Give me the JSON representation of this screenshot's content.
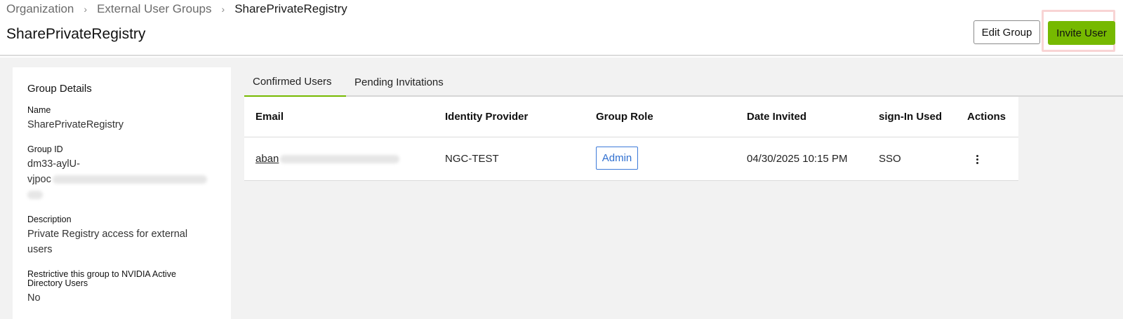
{
  "breadcrumb": {
    "items": [
      "Organization",
      "External User Groups"
    ],
    "current": "SharePrivateRegistry",
    "separator": "›"
  },
  "page": {
    "title": "SharePrivateRegistry"
  },
  "actions": {
    "edit_label": "Edit Group",
    "invite_label": "Invite User"
  },
  "details": {
    "heading": "Group Details",
    "name_label": "Name",
    "name_value": "SharePrivateRegistry",
    "group_id_label": "Group ID",
    "group_id_line1": "dm33-aylU-",
    "group_id_line2_visible": "vjpoc",
    "description_label": "Description",
    "description_value": "Private Registry access for external users",
    "restrict_label": "Restrictive this group to NVIDIA Active Directory Users",
    "restrict_value": "No"
  },
  "tabs": [
    {
      "label": "Confirmed Users",
      "active": true
    },
    {
      "label": "Pending Invitations",
      "active": false
    }
  ],
  "table": {
    "columns": [
      "Email",
      "Identity Provider",
      "Group Role",
      "Date Invited",
      "sign-In Used",
      "Actions"
    ],
    "rows": [
      {
        "email_visible": "aban",
        "identity_provider": "NGC-TEST",
        "group_role": "Admin",
        "date_invited": "04/30/2025 10:15 PM",
        "sign_in_used": "SSO"
      }
    ]
  },
  "icons": {
    "actions": "kebab-menu-icon",
    "separator": "chevron-right-icon"
  },
  "colors": {
    "accent": "#76b900",
    "role_badge": "#2f6fd0",
    "highlight": "#f8d4d4"
  }
}
